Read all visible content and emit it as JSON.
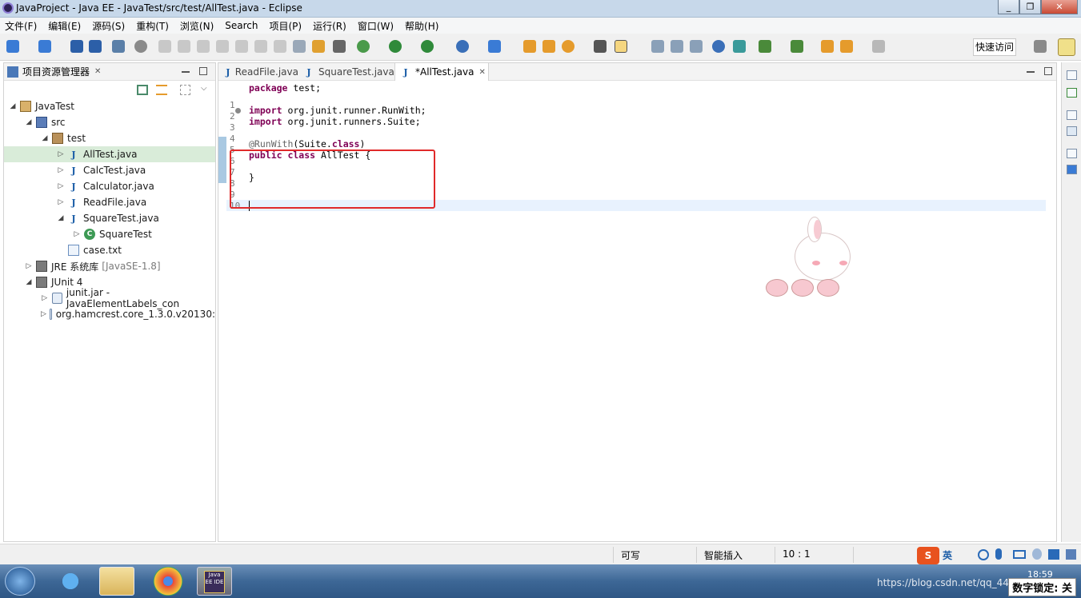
{
  "window": {
    "title": "JavaProject - Java EE - JavaTest/src/test/AllTest.java - Eclipse",
    "controls": [
      "_",
      "❐",
      "✕"
    ]
  },
  "menu": [
    "文件(F)",
    "编辑(E)",
    "源码(S)",
    "重构(T)",
    "浏览(N)",
    "Search",
    "项目(P)",
    "运行(R)",
    "窗口(W)",
    "帮助(H)"
  ],
  "toolbar": {
    "quick_access": "快速访问"
  },
  "explorer": {
    "title": "项目资源管理器",
    "close": "✕",
    "tree": [
      {
        "label": "JavaTest",
        "arrow": "◢",
        "icon": "project-icon"
      },
      {
        "label": "src",
        "arrow": "◢",
        "icon": "source-folder-icon"
      },
      {
        "label": "test",
        "arrow": "◢",
        "icon": "package-icon"
      },
      {
        "label": "AllTest.java",
        "arrow": "▷",
        "icon": "java-file-icon",
        "selected": true
      },
      {
        "label": "CalcTest.java",
        "arrow": "▷",
        "icon": "java-file-icon"
      },
      {
        "label": "Calculator.java",
        "arrow": "▷",
        "icon": "java-file-icon"
      },
      {
        "label": "ReadFile.java",
        "arrow": "▷",
        "icon": "java-file-icon"
      },
      {
        "label": "SquareTest.java",
        "arrow": "◢",
        "icon": "java-file-icon"
      },
      {
        "label": "SquareTest",
        "arrow": "▷",
        "icon": "class-icon"
      },
      {
        "label": "case.txt",
        "arrow": "",
        "icon": "text-file-icon"
      },
      {
        "label": "JRE 系统库",
        "suffix": "[JavaSE-1.8]",
        "arrow": "▷",
        "icon": "library-icon"
      },
      {
        "label": "JUnit 4",
        "arrow": "◢",
        "icon": "library-icon"
      },
      {
        "label": "junit.jar -JavaElementLabels_con",
        "arrow": "▷",
        "icon": "jar-icon"
      },
      {
        "label": "org.hamcrest.core_1.3.0.v20130:",
        "arrow": "▷",
        "icon": "jar-icon"
      }
    ]
  },
  "editor": {
    "tabs": [
      {
        "label": "ReadFile.java",
        "active": false
      },
      {
        "label": "SquareTest.java",
        "active": false
      },
      {
        "label": "*AllTest.java",
        "active": true,
        "close": "✕"
      }
    ],
    "lines": [
      {
        "num": "1",
        "parts": [
          {
            "t": "package",
            "c": "kw"
          },
          {
            "t": " test;",
            "c": ""
          }
        ]
      },
      {
        "num": "2",
        "parts": []
      },
      {
        "num": "3",
        "parts": [
          {
            "t": "import",
            "c": "kw"
          },
          {
            "t": " org.junit.runner.RunWith;",
            "c": ""
          }
        ]
      },
      {
        "num": "4",
        "parts": [
          {
            "t": "import",
            "c": "kw"
          },
          {
            "t": " org.junit.runners.Suite;",
            "c": ""
          }
        ]
      },
      {
        "num": "5",
        "parts": []
      },
      {
        "num": "6",
        "parts": [
          {
            "t": "@RunWith",
            "c": "ann"
          },
          {
            "t": "(Suite.",
            "c": ""
          },
          {
            "t": "class",
            "c": "kw"
          },
          {
            "t": ")",
            "c": ""
          }
        ]
      },
      {
        "num": "7",
        "parts": [
          {
            "t": "public class",
            "c": "kw"
          },
          {
            "t": " AllTest {",
            "c": ""
          }
        ]
      },
      {
        "num": "8",
        "parts": []
      },
      {
        "num": "9",
        "parts": [
          {
            "t": "}",
            "c": ""
          }
        ]
      },
      {
        "num": "10",
        "parts": []
      }
    ]
  },
  "status": {
    "writable": "可写",
    "insert_mode": "智能插入",
    "position": "10 : 1"
  },
  "taskbar": {
    "clock": "18:59",
    "watermark": "https://blog.csdn.net/qq_441425",
    "numlock": "数字锁定: 关"
  },
  "ime": {
    "lang": "英"
  }
}
